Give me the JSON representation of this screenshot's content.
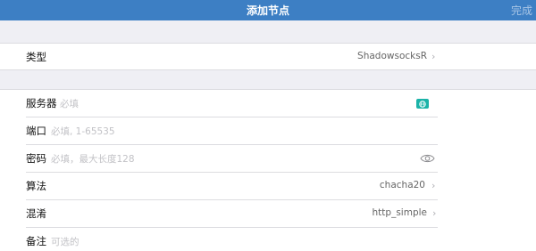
{
  "navbar": {
    "title": "添加节点",
    "done_label": "完成"
  },
  "type_row": {
    "label": "类型",
    "value": "ShadowsocksR"
  },
  "fields": {
    "server": {
      "label": "服务器",
      "placeholder": "必填"
    },
    "port": {
      "label": "端口",
      "placeholder": "必填, 1-65535"
    },
    "password": {
      "label": "密码",
      "placeholder": "必填，最大长度128"
    },
    "method": {
      "label": "算法",
      "value": "chacha20"
    },
    "obfs": {
      "label": "混淆",
      "value": "http_simple"
    },
    "remarks": {
      "label": "备注",
      "placeholder": "可选的"
    }
  },
  "icons": {
    "globe": "globe-icon",
    "eye": "eye-icon",
    "chevron": "chevron-right-icon"
  },
  "colors": {
    "navbar_bg": "#3d7fc4",
    "globe_button": "#1bb3a8",
    "background": "#efeff4"
  }
}
